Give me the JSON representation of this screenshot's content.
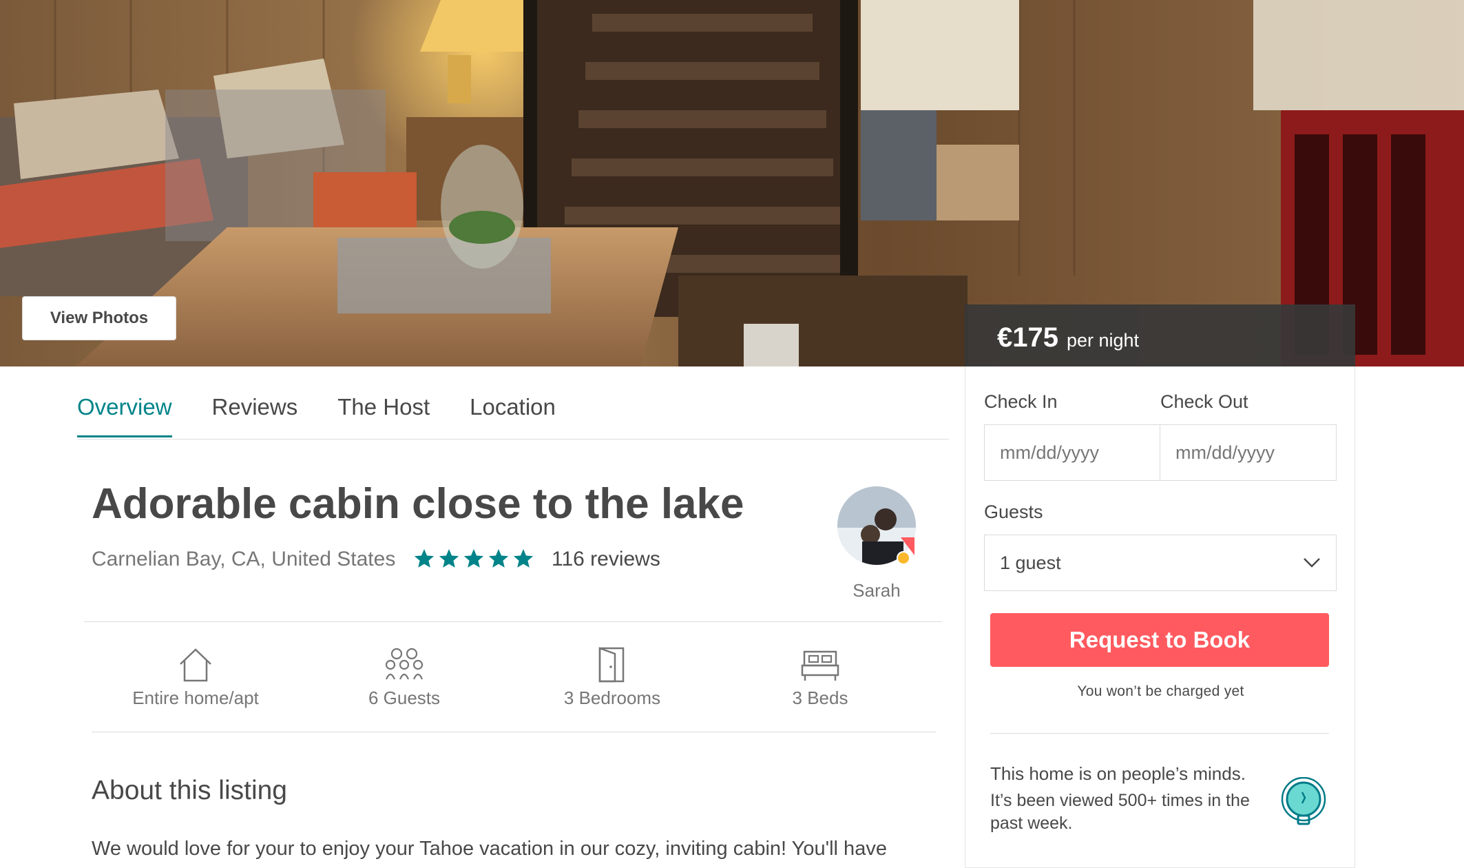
{
  "hero": {
    "view_photos_label": "View Photos"
  },
  "price": {
    "amount": "€175",
    "unit": "per night"
  },
  "tabs": [
    {
      "label": "Overview"
    },
    {
      "label": "Reviews"
    },
    {
      "label": "The Host"
    },
    {
      "label": "Location"
    }
  ],
  "listing": {
    "title": "Adorable cabin close to the lake",
    "location": "Carnelian Bay, CA, United States",
    "rating_stars": 5,
    "reviews": "116 reviews",
    "host_name": "Sarah"
  },
  "amenities": [
    {
      "label": "Entire home/apt",
      "icon": "house-icon"
    },
    {
      "label": "6 Guests",
      "icon": "guests-icon"
    },
    {
      "label": "3 Bedrooms",
      "icon": "door-icon"
    },
    {
      "label": "3 Beds",
      "icon": "bed-icon"
    }
  ],
  "about": {
    "title": "About this listing",
    "text": "We would love for your to enjoy your Tahoe vacation in our cozy, inviting cabin! You'll have"
  },
  "booking": {
    "check_in_label": "Check In",
    "check_out_label": "Check Out",
    "check_in_placeholder": "mm/dd/yyyy",
    "check_out_placeholder": "mm/dd/yyyy",
    "guests_label": "Guests",
    "guests_value": "1 guest",
    "request_button": "Request to Book",
    "not_charged": "You won’t be charged yet",
    "minds_title": "This home is on people’s minds.",
    "minds_text": "It’s been viewed 500+ times in the past week."
  },
  "colors": {
    "accent_teal": "#008489",
    "book_red": "#ff5a5f",
    "price_bar": "#383838",
    "text": "#484848",
    "muted": "#767676"
  }
}
